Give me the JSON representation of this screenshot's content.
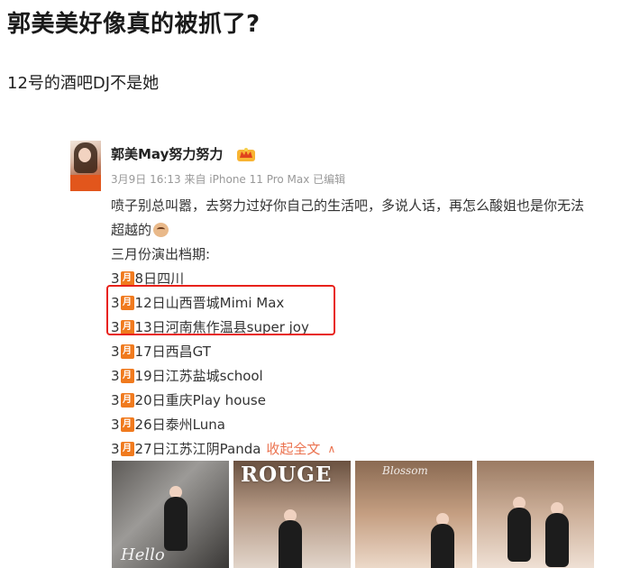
{
  "article": {
    "title": "郭美美好像真的被抓了?",
    "subtitle": "12号的酒吧DJ不是她"
  },
  "post": {
    "username": "郭美May努力努力",
    "meta": "3月9日 16:13 来自 iPhone 11 Pro Max  已编辑",
    "text_line1": "喷子别总叫嚣，去努力过好你自己的生活吧，多说人话，再怎么酸姐也是你无法",
    "text_line2": "超越的",
    "schedule_heading": "三月份演出档期:",
    "month_prefix": "3",
    "month_icon_char": "月",
    "schedule": [
      {
        "text": "8日四川"
      },
      {
        "text": "12日山西晋城Mimi Max"
      },
      {
        "text": "13日河南焦作温县super joy"
      },
      {
        "text": "17日西昌GT"
      },
      {
        "text": "19日江苏盐城school"
      },
      {
        "text": "20日重庆Play house"
      },
      {
        "text": "26日泰州Luna"
      },
      {
        "text": "27日江苏江阴Panda"
      }
    ],
    "collapse_label": "收起全文",
    "collapse_icon": "chevron-up-icon",
    "photos": [
      {
        "overlay": "Hello"
      },
      {
        "overlay": "ROUGE"
      },
      {
        "overlay": "Blossom"
      },
      {
        "overlay": ""
      }
    ]
  },
  "colors": {
    "accent": "#eb7350",
    "calendar_icon": "#f07a1e",
    "highlight": "#e8221b",
    "meta_text": "#999999"
  }
}
